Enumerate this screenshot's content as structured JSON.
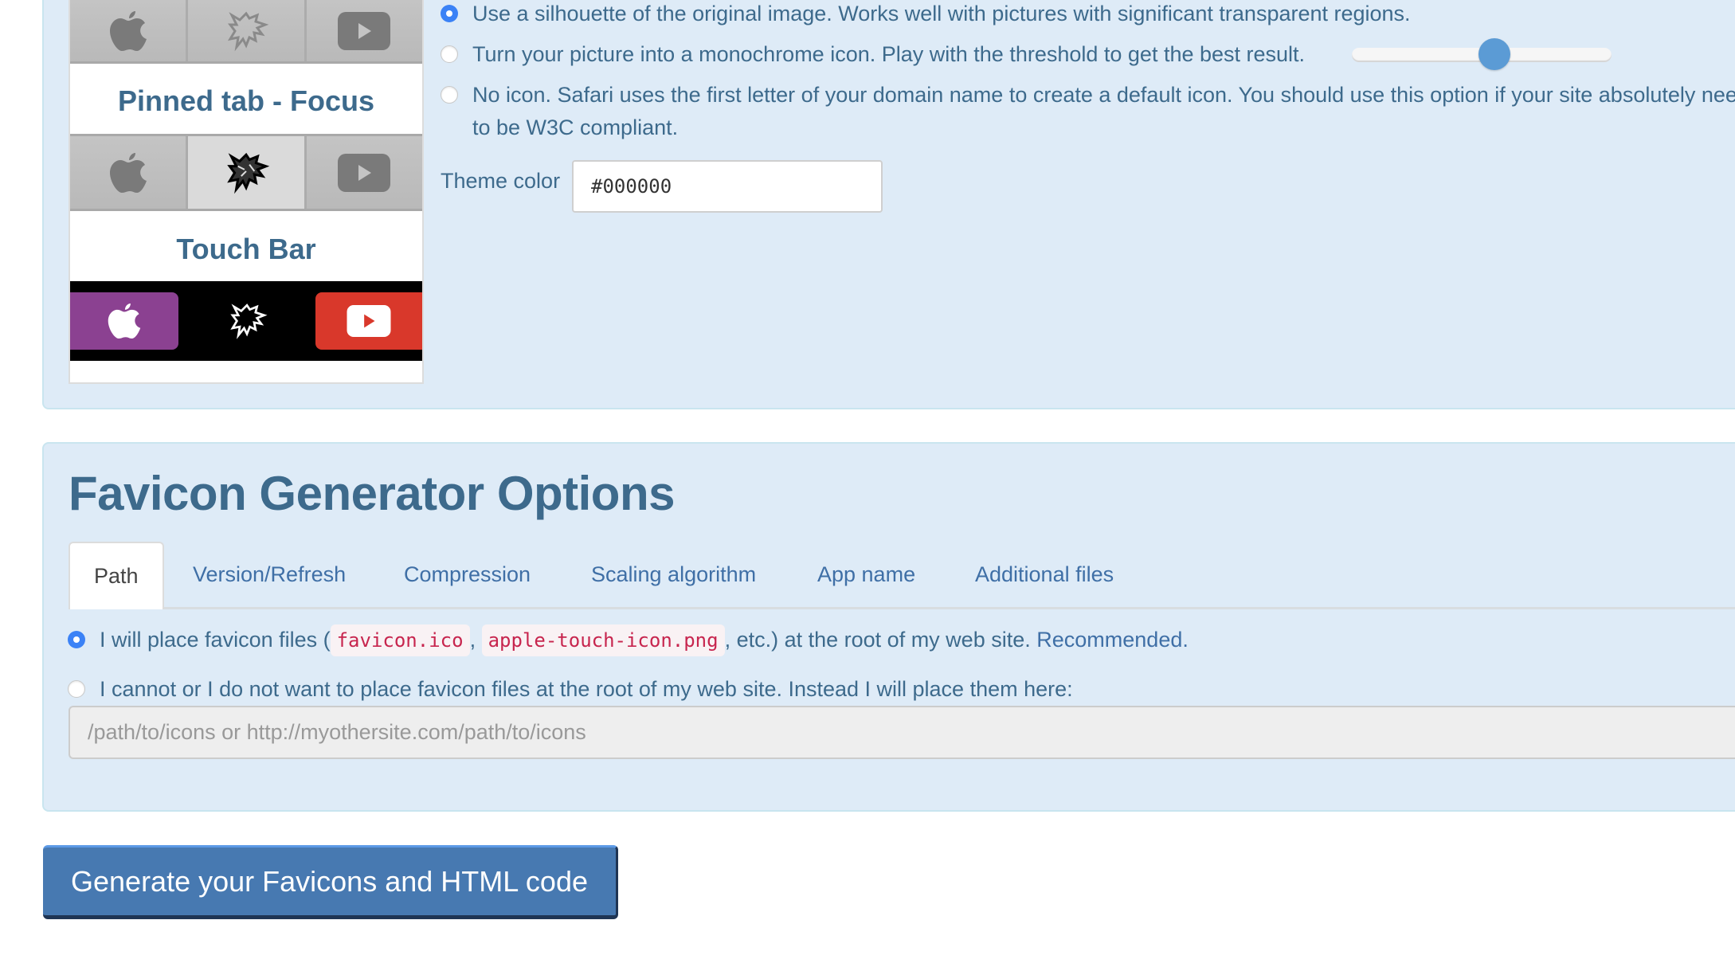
{
  "preview": {
    "labels": {
      "pinned_focus": "Pinned tab - Focus",
      "touch_bar": "Touch Bar"
    },
    "icons": [
      "apple-icon",
      "wolf-logo-icon",
      "youtube-icon"
    ],
    "touch_bar_colors": {
      "apple": "#8b4191",
      "youtube": "#d9382b"
    }
  },
  "safari_options": {
    "options": [
      {
        "label": "Use a silhouette of the original image. Works well with pictures with significant transparent regions.",
        "checked": true
      },
      {
        "label": "Turn your picture into a monochrome icon. Play with the threshold to get the best result.",
        "checked": false
      },
      {
        "label": "No icon. Safari uses the first letter of your domain name to create a default icon. You should use this option if your site absolutely needs",
        "label_line2": "to be W3C compliant.",
        "checked": false
      }
    ],
    "threshold_slider": {
      "value_fraction": 0.55
    },
    "theme_color_label": "Theme color",
    "theme_color_value": "#000000"
  },
  "options_panel": {
    "heading": "Favicon Generator Options",
    "tabs": [
      {
        "label": "Path",
        "active": true
      },
      {
        "label": "Version/Refresh",
        "active": false
      },
      {
        "label": "Compression",
        "active": false
      },
      {
        "label": "Scaling algorithm",
        "active": false
      },
      {
        "label": "App name",
        "active": false
      },
      {
        "label": "Additional files",
        "active": false
      }
    ],
    "path": {
      "option1": {
        "prefix": "I will place favicon files (",
        "code1": "favicon.ico",
        "sep": ",",
        "code2": "apple-touch-icon.png",
        "suffix": ", etc.) at the root of my web site.",
        "link": "Recommended.",
        "checked": true
      },
      "option2": {
        "label": "I cannot or I do not want to place favicon files at the root of my web site. Instead I will place them here:",
        "checked": false
      },
      "input_placeholder": "/path/to/icons or http://myothersite.com/path/to/icons",
      "input_value": ""
    }
  },
  "generate_button": {
    "label": "Generate your Favicons and HTML code"
  },
  "colors": {
    "panel_bg": "#deebf7",
    "text": "#3d6a8c",
    "link": "#3f6fa6",
    "button": "#4779b1",
    "radio_checked": "#3b82f6",
    "code": "#c7254e"
  }
}
